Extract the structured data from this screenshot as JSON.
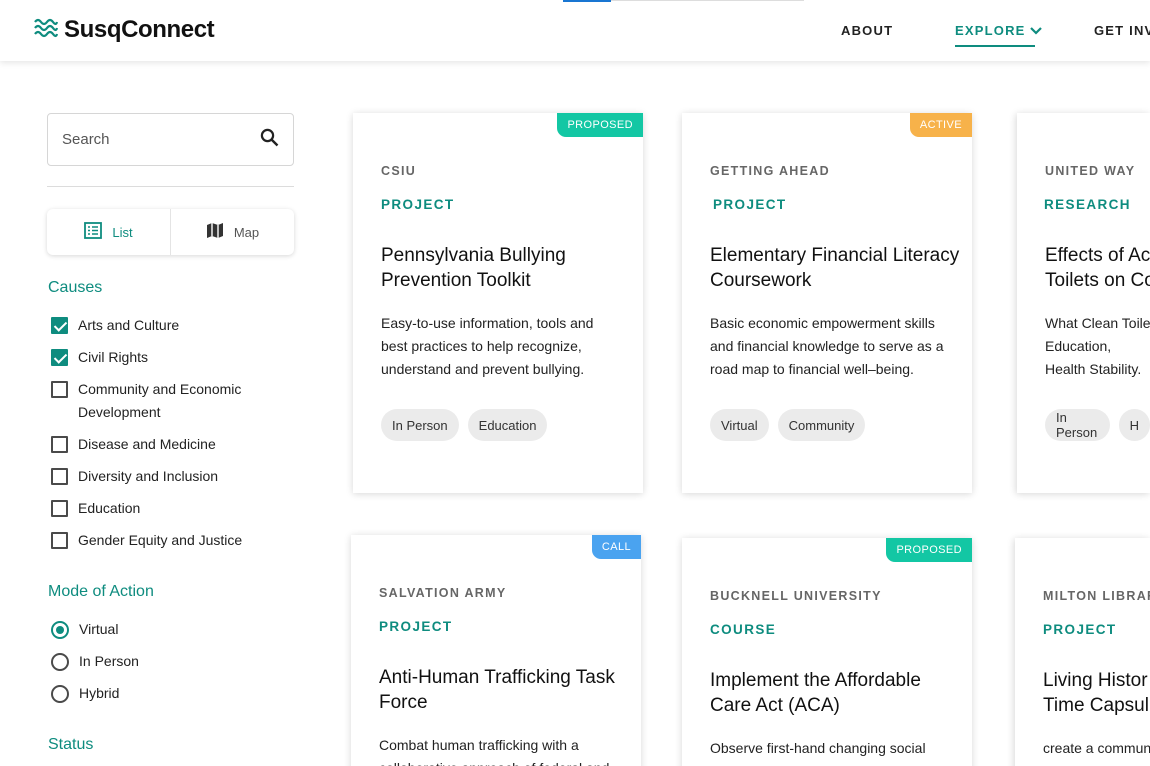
{
  "header": {
    "brand": "SusqConnect",
    "nav": {
      "about": "ABOUT",
      "explore": "EXPLORE",
      "get_involved": "GET INV"
    }
  },
  "sidebar": {
    "search_placeholder": "Search",
    "view_toggle": {
      "list": "List",
      "map": "Map",
      "selected": "List"
    },
    "causes": {
      "title": "Causes",
      "items": [
        {
          "label": "Arts and Culture",
          "checked": true
        },
        {
          "label": "Civil Rights",
          "checked": true
        },
        {
          "label": "Community and Economic Development",
          "checked": false
        },
        {
          "label": "Disease and Medicine",
          "checked": false
        },
        {
          "label": "Diversity and Inclusion",
          "checked": false
        },
        {
          "label": "Education",
          "checked": false
        },
        {
          "label": "Gender Equity and Justice",
          "checked": false
        }
      ]
    },
    "mode": {
      "title": "Mode of Action",
      "items": [
        {
          "label": "Virtual",
          "selected": true
        },
        {
          "label": "In Person",
          "selected": false
        },
        {
          "label": "Hybrid",
          "selected": false
        }
      ]
    },
    "status": {
      "title": "Status"
    }
  },
  "cards": [
    {
      "badge": "PROPOSED",
      "badge_color": "#13c7a4",
      "org": "CSIU",
      "type": "PROJECT",
      "title": "Pennsylvania Bullying Prevention Toolkit",
      "description": "Easy-to-use information, tools and best practices to help recognize, understand and prevent bullying.",
      "tags": [
        "In Person",
        "Education"
      ]
    },
    {
      "badge": "ACTIVE",
      "badge_color": "#f7b24a",
      "org": "GETTING AHEAD",
      "type": "PROJECT",
      "title": "Elementary Financial Literacy Coursework",
      "description": "Basic economic empowerment skills and financial knowledge to serve as a road map to financial well–being.",
      "tags": [
        "Virtual",
        "Community"
      ]
    },
    {
      "badge": "",
      "badge_color": "",
      "org": "UNITED WAY",
      "type": "RESEARCH",
      "title": "Effects of Ac Toilets on Co",
      "description": "What Clean Toile Education, Health Stability.",
      "tags": [
        "In Person",
        "H"
      ]
    },
    {
      "badge": "CALL",
      "badge_color": "#4aa3f0",
      "org": "SALVATION ARMY",
      "type": "PROJECT",
      "title": "Anti-Human Trafficking Task Force",
      "description": "Combat human trafficking with a collaborative approach of federal and",
      "tags": []
    },
    {
      "badge": "PROPOSED",
      "badge_color": "#13c7a4",
      "org": "BUCKNELL UNIVERSITY",
      "type": "COURSE",
      "title": "Implement the Affordable Care Act (ACA)",
      "description": "Observe first-hand changing social policies and their impact on",
      "tags": []
    },
    {
      "badge": "",
      "badge_color": "",
      "org": "MILTON LIBRAR",
      "type": "PROJECT",
      "title": "Living Histor Time Capsul",
      "description": "create a commun",
      "tags": []
    }
  ]
}
